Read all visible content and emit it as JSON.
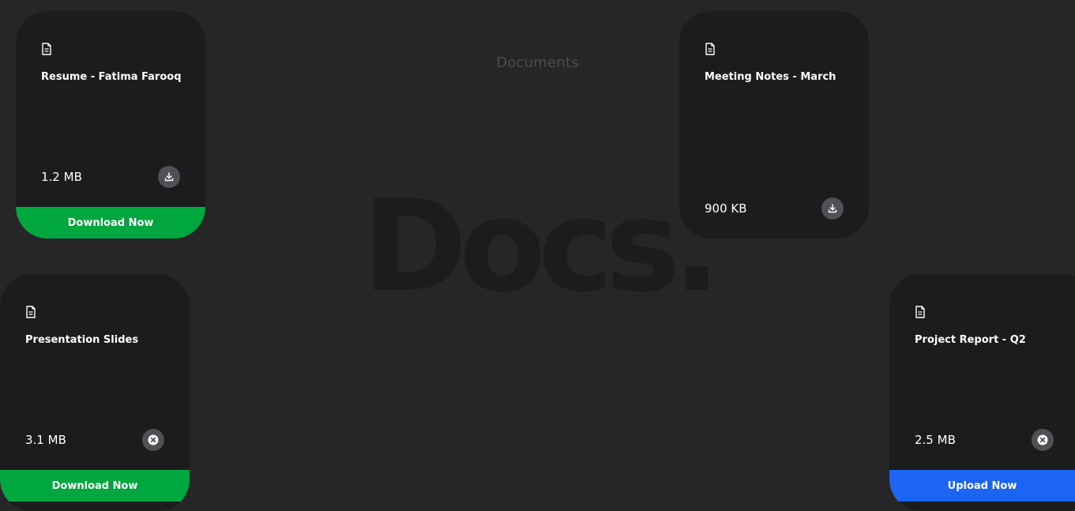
{
  "page": {
    "heading": "Documents",
    "background_word": "Docs."
  },
  "colors": {
    "background": "#262628",
    "card": "#1c1c1e",
    "download_action": "#00a63e",
    "upload_action": "#1c64f2",
    "icon_button": "#505055"
  },
  "cards": [
    {
      "title": "Resume - Fatima Farooq",
      "size": "1.2 MB",
      "icon": "document-icon",
      "button_icon": "download-icon",
      "action_label": "Download Now",
      "action_color": "green"
    },
    {
      "title": "Meeting Notes - March",
      "size": "900 KB",
      "icon": "document-icon",
      "button_icon": "download-icon",
      "action_label": "",
      "action_color": ""
    },
    {
      "title": "Presentation Slides",
      "size": "3.1 MB",
      "icon": "document-icon",
      "button_icon": "close-circle-icon",
      "action_label": "Download Now",
      "action_color": "green"
    },
    {
      "title": "Project Report - Q2",
      "size": "2.5 MB",
      "icon": "document-icon",
      "button_icon": "close-circle-icon",
      "action_label": "Upload Now",
      "action_color": "blue"
    }
  ]
}
